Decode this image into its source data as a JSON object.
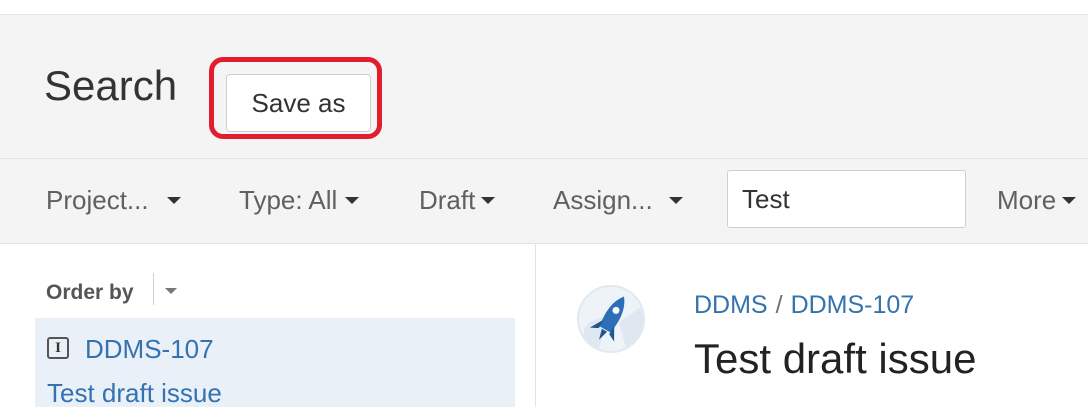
{
  "header": {
    "title": "Search",
    "save_as_label": "Save as"
  },
  "filters": {
    "project": "Project...",
    "type": "Type: All",
    "status": "Draft",
    "assignee": "Assign...",
    "text_search_value": "Test",
    "more": "More"
  },
  "results": {
    "order_by_label": "Order by",
    "items": [
      {
        "key": "DDMS-107",
        "summary": "Test draft issue"
      }
    ]
  },
  "detail": {
    "project": "DDMS",
    "breadcrumb_separator": "/",
    "issue_key": "DDMS-107",
    "summary": "Test draft issue",
    "avatar_icon": "rocket-icon"
  },
  "colors": {
    "link": "#3572b0",
    "highlight": "#e01e2e",
    "selected_row": "#e9f0f8",
    "header_bg": "#f4f4f4"
  }
}
